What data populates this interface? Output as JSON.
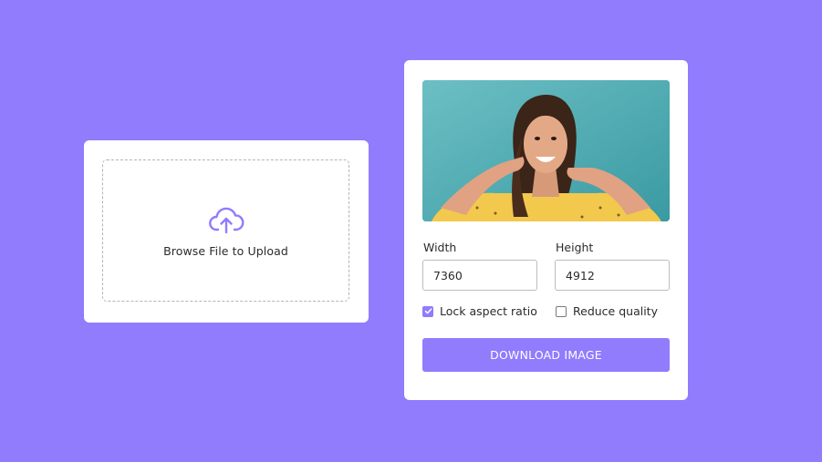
{
  "upload": {
    "icon": "cloud-upload-icon",
    "label": "Browse File to Upload"
  },
  "resizer": {
    "preview_image": "woman-portrait-photo",
    "width_label": "Width",
    "width_value": "7360",
    "height_label": "Height",
    "height_value": "4912",
    "lock_aspect_label": "Lock aspect ratio",
    "lock_aspect_checked": true,
    "reduce_quality_label": "Reduce quality",
    "reduce_quality_checked": false,
    "download_label": "DOWNLOAD IMAGE"
  },
  "colors": {
    "background": "#907cfd",
    "accent": "#907cfd",
    "card": "#ffffff"
  }
}
